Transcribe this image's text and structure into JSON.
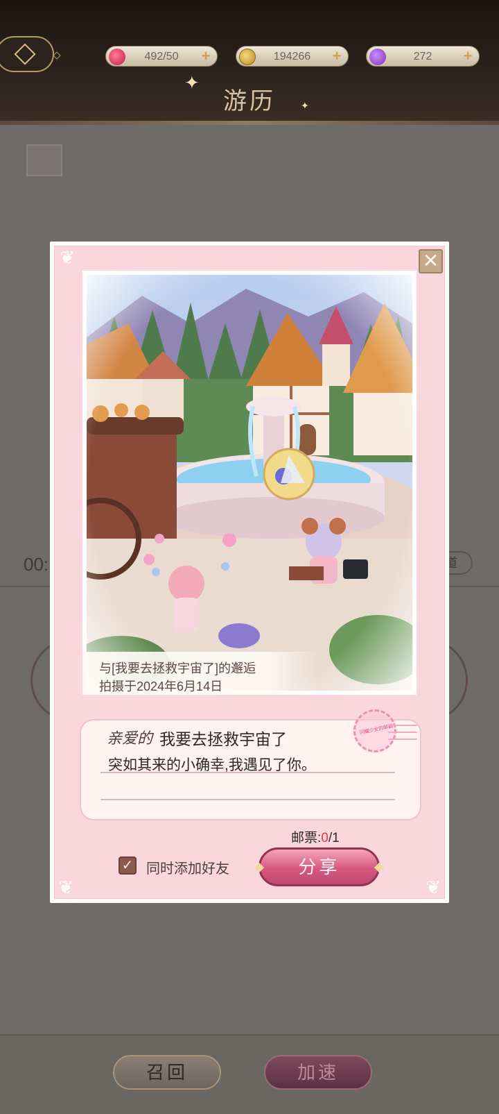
{
  "header": {
    "title": "游历",
    "currencies": [
      {
        "icon": "heart-icon",
        "value": "492/50"
      },
      {
        "icon": "coin-icon",
        "value": "194266"
      },
      {
        "icon": "gem-icon",
        "value": "272"
      }
    ]
  },
  "background": {
    "timer_partial": "00:",
    "pill_partial": "道"
  },
  "dialog": {
    "photo": {
      "caption_line1": "与[我要去拯救宇宙了]的邂逅",
      "caption_line2": "拍摄于2024年6月14日"
    },
    "letter": {
      "greeting": "亲爱的",
      "recipient": "我要去拯救宇宙了",
      "body": "突如其来的小确幸,我遇见了你。"
    },
    "stamp_text": "闪耀少女的邮戳",
    "stamps": {
      "label": "邮票:",
      "current": "0",
      "separator": "/",
      "total": "1"
    },
    "add_friend": {
      "label": "同时添加好友",
      "checked": true
    },
    "share_label": "分享",
    "close_symbol": "✕"
  },
  "footer": {
    "recall_label": "召回",
    "speedup_label": "加速"
  },
  "colors": {
    "dialog_bg": "#f9d7dd",
    "share_button": "#d8577f",
    "stamp_count": "#e63a3a",
    "checkbox": "#8a5a4f"
  }
}
